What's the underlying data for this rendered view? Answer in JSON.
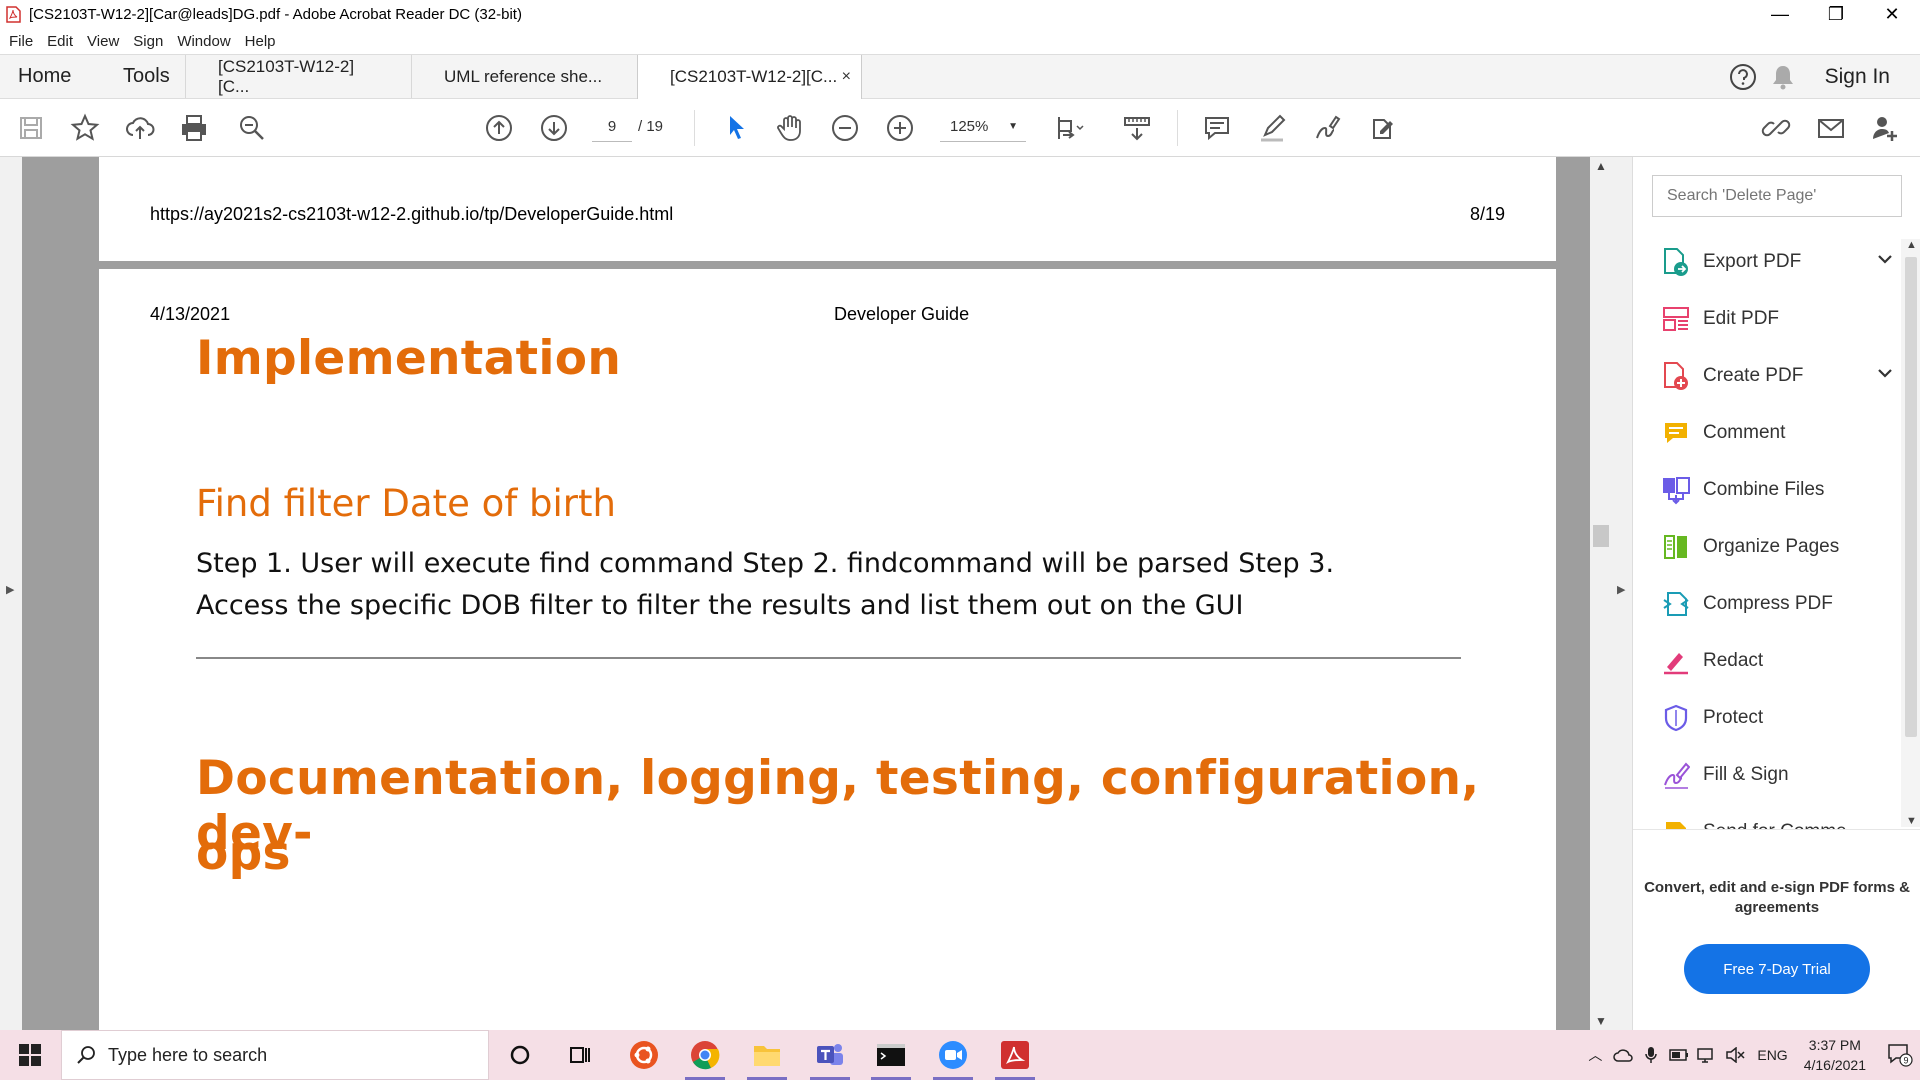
{
  "window": {
    "title": "[CS2103T-W12-2][Car@leads]DG.pdf - Adobe Acrobat Reader DC (32-bit)",
    "minimize": "—",
    "restore": "❐",
    "close": "✕"
  },
  "menu": [
    "File",
    "Edit",
    "View",
    "Sign",
    "Window",
    "Help"
  ],
  "tabs": {
    "home": "Home",
    "tools": "Tools",
    "docs": [
      "[CS2103T-W12-2][C...",
      "UML reference she...",
      "[CS2103T-W12-2][C..."
    ],
    "close_glyph": "×",
    "sign_in": "Sign In"
  },
  "toolbar": {
    "current_page": "9",
    "total_pages": "/  19",
    "zoom": "125%",
    "icons": [
      "save-icon",
      "bookmark-star-icon",
      "upload-cloud-icon",
      "print-icon",
      "search-zoom-icon",
      "page-up-icon",
      "page-down-icon",
      "select-arrow-icon",
      "hand-icon",
      "zoom-out-icon",
      "zoom-in-icon",
      "fit-page-icon",
      "scroll-mode-icon",
      "comment-icon",
      "highlight-icon",
      "sign-icon",
      "share-edit-icon",
      "link-icon",
      "mail-icon",
      "add-user-icon"
    ]
  },
  "document": {
    "page1": {
      "url": "https://ay2021s2-cs2103t-w12-2.github.io/tp/DeveloperGuide.html",
      "page_no": "8/19"
    },
    "page2": {
      "date": "4/13/2021",
      "header_title": "Developer Guide",
      "heading1": "Implementation",
      "heading2": "Find filter Date of birth",
      "paragraph": "Step 1. User will execute find command Step 2. findcommand will be parsed Step 3. Access the specific DOB filter to filter the results and list them out on the GUI",
      "heading3_line1": "Documentation, logging, testing, configuration, dev-",
      "heading3_line2": "ops"
    },
    "accent_color": "#e36c0a"
  },
  "tools_pane": {
    "search_placeholder": "Search 'Delete Page'",
    "items": [
      {
        "label": "Export PDF",
        "icon": "export-pdf-icon",
        "color": "#1a9c8c"
      },
      {
        "label": "Edit PDF",
        "icon": "edit-pdf-icon",
        "color": "#e8416e"
      },
      {
        "label": "Create PDF",
        "icon": "create-pdf-icon",
        "color": "#e34850"
      },
      {
        "label": "Comment",
        "icon": "comment-tool-icon",
        "color": "#f2b100"
      },
      {
        "label": "Combine Files",
        "icon": "combine-files-icon",
        "color": "#6b5ce7"
      },
      {
        "label": "Organize Pages",
        "icon": "organize-pages-icon",
        "color": "#66b821"
      },
      {
        "label": "Compress PDF",
        "icon": "compress-pdf-icon",
        "color": "#1a9cb5"
      },
      {
        "label": "Redact",
        "icon": "redact-icon",
        "color": "#e23b7a"
      },
      {
        "label": "Protect",
        "icon": "protect-icon",
        "color": "#6b5ce7"
      },
      {
        "label": "Fill & Sign",
        "icon": "fill-sign-icon",
        "color": "#9a53d8"
      },
      {
        "label": "Send for Comme",
        "icon": "send-comment-icon",
        "color": "#f2b100"
      }
    ],
    "promo": "Convert, edit and e-sign PDF forms & agreements",
    "trial_button": "Free 7-Day Trial",
    "button_color": "#1473e6"
  },
  "taskbar": {
    "search_text": "Type here to search",
    "lang": "ENG",
    "time": "3:37 PM",
    "date": "4/16/2021",
    "notification_count": "9",
    "apps": [
      "cortana-icon",
      "task-view-icon",
      "ubuntu-icon",
      "chrome-icon",
      "file-explorer-icon",
      "teams-icon",
      "terminal-icon",
      "zoom-icon",
      "acrobat-icon"
    ]
  }
}
